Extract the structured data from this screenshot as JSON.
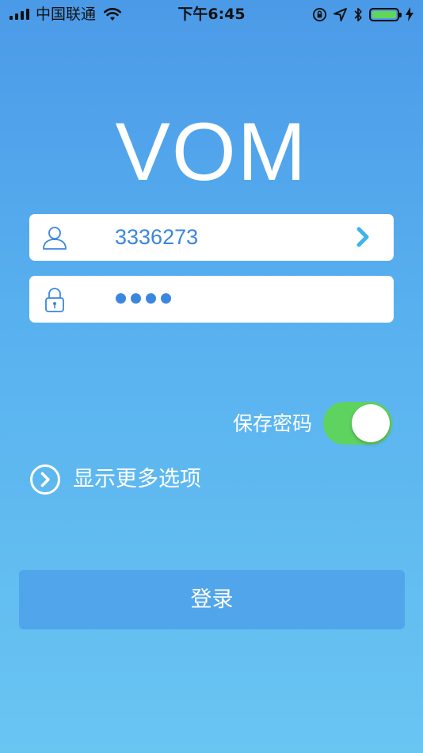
{
  "status_bar": {
    "carrier": "中国联通",
    "time": "下午6:45",
    "battery_color": "#63d55a",
    "icons": [
      "signal-icon",
      "wifi-icon",
      "orientation-lock-icon",
      "location-icon",
      "bluetooth-icon",
      "battery-icon",
      "charging-icon"
    ]
  },
  "app": {
    "title": "VOM"
  },
  "form": {
    "username": {
      "value": "3336273",
      "leading_icon": "user-icon",
      "trailing_icon": "chevron-right-icon"
    },
    "password": {
      "masked_length": 4,
      "leading_icon": "lock-icon"
    },
    "save_password": {
      "label": "保存密码",
      "on": true,
      "color": "#5fd35f"
    },
    "more_options": {
      "label": "显示更多选项",
      "icon": "circle-chevron-right-icon"
    },
    "login_button": {
      "label": "登录",
      "color": "#51a5ea"
    }
  },
  "colors": {
    "background_top": "#4b9ae8",
    "background_bottom": "#69c5f2",
    "accent": "#3a86e0"
  }
}
